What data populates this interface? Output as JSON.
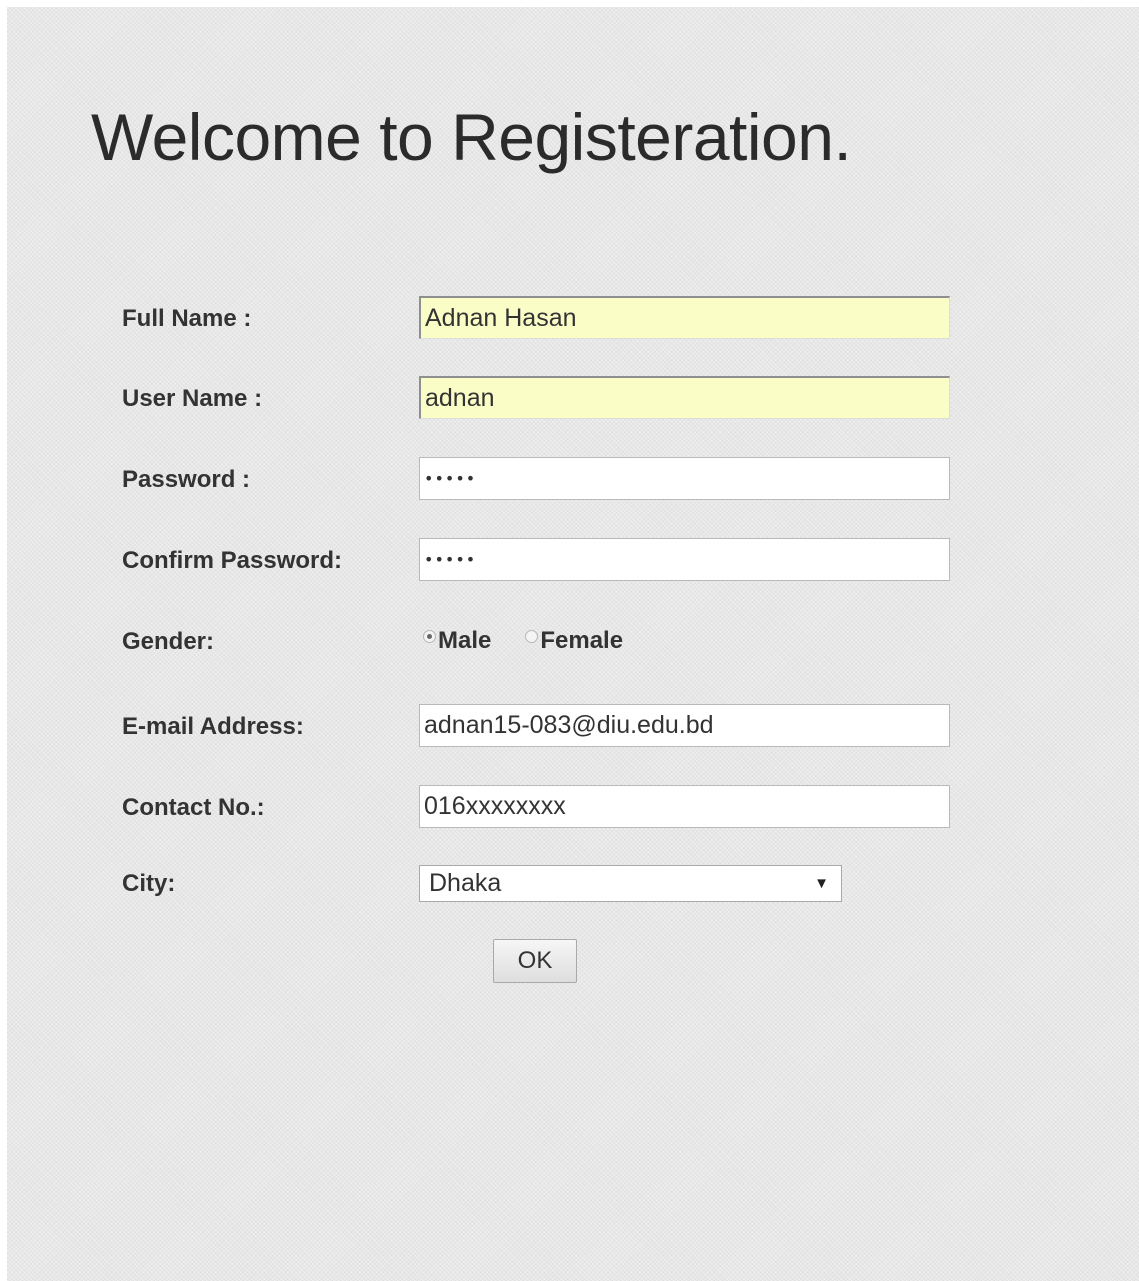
{
  "page_title": "Welcome to Registeration.",
  "form": {
    "full_name": {
      "label": "Full Name :",
      "value": "Adnan Hasan"
    },
    "user_name": {
      "label": "User Name :",
      "value": "adnan"
    },
    "password": {
      "label": "Password :",
      "value": "•••••"
    },
    "confirm_password": {
      "label": "Confirm Password:",
      "value": "•••••"
    },
    "gender": {
      "label": "Gender:",
      "options": [
        {
          "label": "Male",
          "checked": true
        },
        {
          "label": "Female",
          "checked": false
        }
      ]
    },
    "email": {
      "label": "E-mail Address:",
      "value": "adnan15-083@diu.edu.bd"
    },
    "contact": {
      "label": "Contact No.:",
      "value": "016xxxxxxxx"
    },
    "city": {
      "label": "City:",
      "selected": "Dhaka",
      "arrow_glyph": "▼"
    },
    "submit_label": "OK"
  },
  "icons": {
    "dropdown": "chevron-down-icon"
  }
}
